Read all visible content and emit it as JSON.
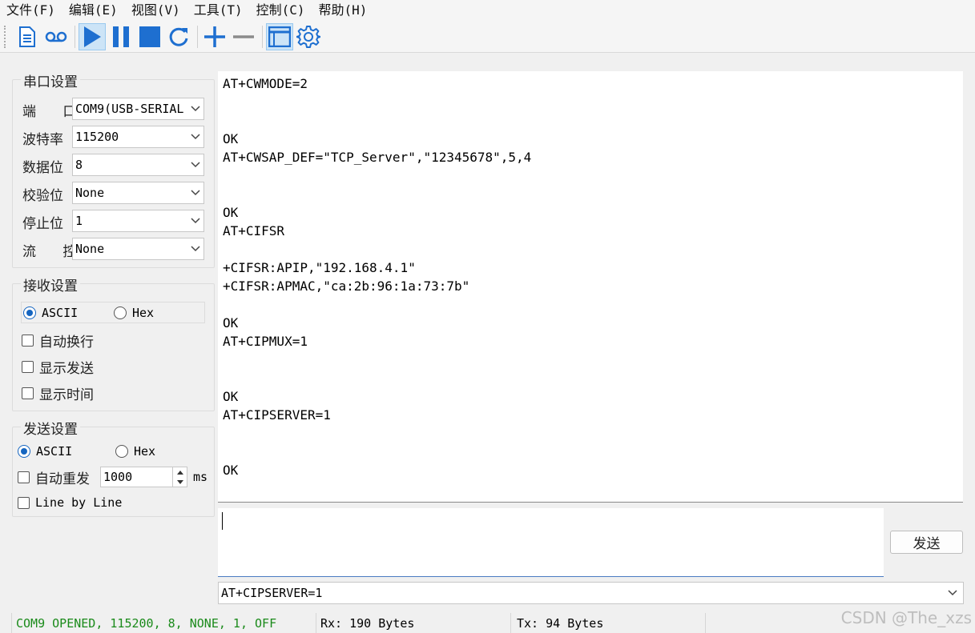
{
  "menu": [
    "文件(F)",
    "编辑(E)",
    "视图(V)",
    "工具(T)",
    "控制(C)",
    "帮助(H)"
  ],
  "toolbar": {
    "icons": [
      "new-file-icon",
      "record-icon",
      "play-icon",
      "pause-icon",
      "stop-icon",
      "refresh-icon",
      "plus-icon",
      "minus-icon",
      "window-icon",
      "settings-gear-icon"
    ],
    "accent": "#1e6fd0"
  },
  "serial": {
    "title": "串口设置",
    "port_label": "端  口",
    "port_value": "COM9(USB-SERIAL",
    "baud_label": "波特率",
    "baud_value": "115200",
    "databits_label": "数据位",
    "databits_value": "8",
    "parity_label": "校验位",
    "parity_value": "None",
    "stopbits_label": "停止位",
    "stopbits_value": "1",
    "flow_label": "流  控",
    "flow_value": "None"
  },
  "receive": {
    "title": "接收设置",
    "ascii": "ASCII",
    "hex": "Hex",
    "selected": "ASCII",
    "auto_wrap": "自动换行",
    "show_send": "显示发送",
    "show_time": "显示时间"
  },
  "send": {
    "title": "发送设置",
    "ascii": "ASCII",
    "hex": "Hex",
    "selected": "ASCII",
    "auto_resend": "自动重发",
    "interval": "1000",
    "unit": "ms",
    "line_by_line": "Line by Line",
    "send_button": "发送",
    "history_value": "AT+CIPSERVER=1"
  },
  "recv_text": "AT+CWMODE=2\n\n\nOK\nAT+CWSAP_DEF=\"TCP_Server\",\"12345678\",5,4\n\n\nOK\nAT+CIFSR\n\n+CIFSR:APIP,\"192.168.4.1\"\n+CIFSR:APMAC,\"ca:2b:96:1a:73:7b\"\n\nOK\nAT+CIPMUX=1\n\n\nOK\nAT+CIPSERVER=1\n\n\nOK",
  "status": {
    "port_status": "COM9 OPENED, 115200, 8, NONE, 1, OFF",
    "port_status_color": "#1a8a1a",
    "rx": "Rx: 190 Bytes",
    "tx": "Tx: 94 Bytes"
  },
  "watermark": "CSDN @The_xzs"
}
